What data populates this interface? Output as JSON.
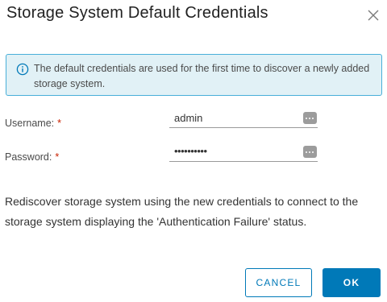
{
  "dialog": {
    "title": "Storage System Default Credentials",
    "close_icon": "close-icon"
  },
  "alert": {
    "icon": "info-icon",
    "message": "The default credentials are used for the first time to discover a newly added storage system."
  },
  "form": {
    "username": {
      "label": "Username:",
      "required_marker": "*",
      "value": "admin",
      "icon": "more-dots-icon"
    },
    "password": {
      "label": "Password:",
      "required_marker": "*",
      "value": "••••••••••",
      "icon": "more-dots-icon"
    }
  },
  "description": "Rediscover storage system using the new credentials to connect to the storage system displaying the 'Authentication Failure' status.",
  "buttons": {
    "cancel": "CANCEL",
    "ok": "OK"
  },
  "colors": {
    "accent": "#0079b8",
    "alert_bg": "#e1f1f6",
    "alert_border": "#49afd9",
    "required": "#c92100"
  }
}
